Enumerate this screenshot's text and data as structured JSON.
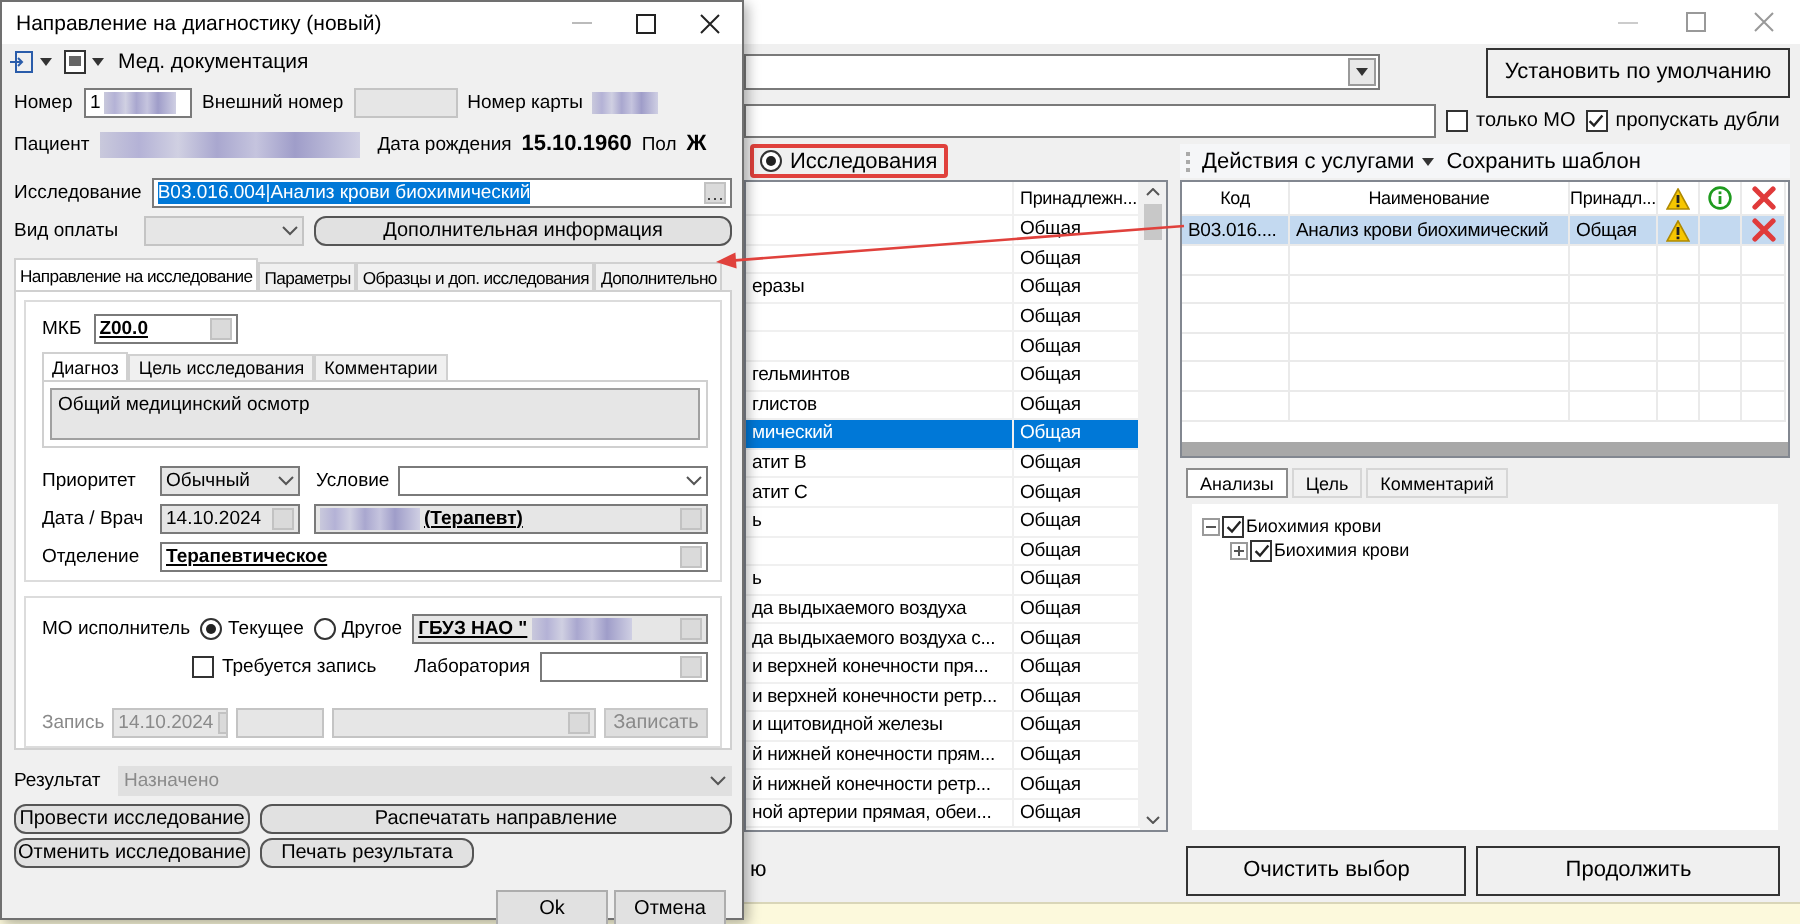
{
  "dialog": {
    "title": "Направление на диагностику (новый)",
    "toolbar_label": "Мед. документация",
    "number": {
      "label": "Номер",
      "value": "1"
    },
    "external_number": {
      "label": "Внешний номер"
    },
    "card_number": {
      "label": "Номер карты"
    },
    "patient": {
      "label": "Пациент"
    },
    "birth_date": {
      "label": "Дата рождения",
      "value": "15.10.1960"
    },
    "sex": {
      "label": "Пол",
      "value": "Ж"
    },
    "study": {
      "label": "Исследование",
      "value": "B03.016.004|Анализ крови биохимический",
      "selected": true
    },
    "payment": {
      "label": "Вид оплаты",
      "disabled": true
    },
    "extra_info_button": "Дополнительная информация",
    "tabs": [
      {
        "label": "Направление на исследование",
        "selected": true
      },
      {
        "label": "Параметры",
        "selected": false
      },
      {
        "label": "Образцы и доп. исследования",
        "selected": false
      },
      {
        "label": "Дополнительно",
        "selected": false
      }
    ],
    "mkb": {
      "label": "МКБ",
      "value": "Z00.0"
    },
    "subtabs": [
      {
        "label": "Диагноз",
        "selected": true
      },
      {
        "label": "Цель исследования",
        "selected": false
      },
      {
        "label": "Комментарии",
        "selected": false
      }
    ],
    "diagnosis_text": "Общий медицинский осмотр",
    "priority": {
      "label": "Приоритет",
      "value": "Обычный"
    },
    "condition": {
      "label": "Условие"
    },
    "date_doctor": {
      "label": "Дата / Врач",
      "date": "14.10.2024",
      "doctor": "(Терапевт)"
    },
    "department": {
      "label": "Отделение",
      "value": "Терапевтическое"
    },
    "executor": {
      "label": "МО исполнитель",
      "value": "ГБУЗ НАО \"",
      "options": [
        {
          "label": "Текущее",
          "selected": true
        },
        {
          "label": "Другое",
          "selected": false
        }
      ]
    },
    "record_required": {
      "label": "Требуется запись",
      "checked": false
    },
    "laboratory": {
      "label": "Лаборатория"
    },
    "record": {
      "label": "Запись",
      "date": "14.10.2024",
      "button": "Записать",
      "disabled": true
    },
    "result": {
      "label": "Результат",
      "value": "Назначено",
      "disabled": true
    },
    "actions": [
      "Провести исследование",
      "Распечатать направление",
      "Отменить исследование",
      "Печать результата"
    ],
    "footer_buttons": [
      "Ok",
      "Отмена"
    ]
  },
  "main": {
    "default_button": "Установить по умолчанию",
    "filters": [
      {
        "label": "только МО",
        "checked": false
      },
      {
        "label": "пропускать дубли",
        "checked": true
      }
    ],
    "mode": {
      "label": "Исследования",
      "selected": true
    },
    "list": {
      "header": "Принадлежн...",
      "rows": [
        {
          "group": "Общая",
          "selected": false
        },
        {
          "group": "Общая",
          "selected": false
        },
        {
          "name": "еразы",
          "group": "Общая",
          "selected": false
        },
        {
          "group": "Общая",
          "selected": false
        },
        {
          "group": "Общая",
          "selected": false
        },
        {
          "name": "гельминтов",
          "group": "Общая",
          "selected": false
        },
        {
          "name": "глистов",
          "group": "Общая",
          "selected": false
        },
        {
          "name": "мический",
          "group": "Общая",
          "selected": true
        },
        {
          "name": "атит В",
          "group": "Общая",
          "selected": false
        },
        {
          "name": "атит С",
          "group": "Общая",
          "selected": false
        },
        {
          "name": "ь",
          "group": "Общая",
          "selected": false
        },
        {
          "group": "Общая",
          "selected": false
        },
        {
          "name": "ь",
          "group": "Общая",
          "selected": false
        },
        {
          "name": "да выдыхаемого воздуха",
          "group": "Общая",
          "selected": false
        },
        {
          "name": "да выдыхаемого воздуха с...",
          "group": "Общая",
          "selected": false
        },
        {
          "name": "и верхней конечности пря...",
          "group": "Общая",
          "selected": false
        },
        {
          "name": "и верхней конечности ретр...",
          "group": "Общая",
          "selected": false
        },
        {
          "name": "и щитовидной железы",
          "group": "Общая",
          "selected": false
        },
        {
          "name": "й нижней конечности прям...",
          "group": "Общая",
          "selected": false
        },
        {
          "name": "й нижней конечности ретр...",
          "group": "Общая",
          "selected": false
        },
        {
          "name": "ной артерии прямая, обеи...",
          "group": "Общая",
          "selected": false
        }
      ]
    },
    "services_toolbar": {
      "actions_menu": "Действия с услугами",
      "save_template": "Сохранить шаблон"
    },
    "services": {
      "columns": [
        "Код",
        "Наименование",
        "Принадл..."
      ],
      "rows": [
        {
          "code": "B03.016....",
          "name": "Анализ крови биохимический",
          "group": "Общая",
          "warning": true,
          "selected": true
        }
      ]
    },
    "detail_tabs": [
      {
        "label": "Анализы",
        "selected": true
      },
      {
        "label": "Цель",
        "selected": false
      },
      {
        "label": "Комментарий",
        "selected": false
      }
    ],
    "tree": [
      {
        "label": "Биохимия крови",
        "checked": true,
        "expanded": true,
        "children": [
          {
            "label": "Биохимия крови",
            "checked": true,
            "expanded": false
          }
        ]
      }
    ],
    "footer_label": "ю",
    "buttons": [
      "Очистить выбор",
      "Продолжить"
    ]
  }
}
